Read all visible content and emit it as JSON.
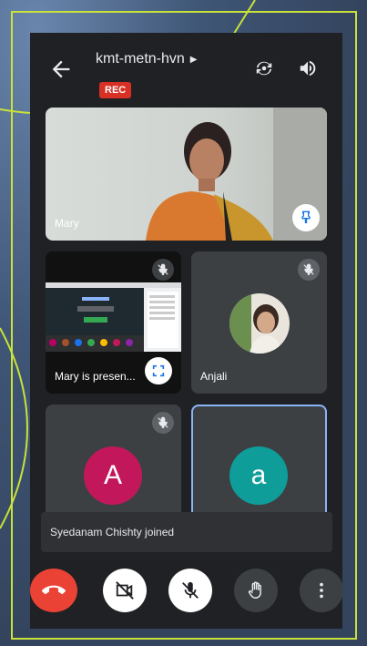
{
  "meeting": {
    "code": "kmt-metn-hvn",
    "rec_label": "REC"
  },
  "tiles": {
    "main": {
      "name": "Mary"
    },
    "presentation": {
      "name": "Mary is presen..."
    },
    "anjali": {
      "name": "Anjali"
    },
    "participant_a1": {
      "initial": "A"
    },
    "participant_a2": {
      "initial": "a"
    }
  },
  "toast": {
    "text": "Syedanam Chishty joined"
  },
  "colors": {
    "rec": "#d93025",
    "end_call": "#ea4335",
    "avatar_a1": "#c2185b",
    "avatar_a2": "#0f9d9a",
    "frame_accent": "#c9e23a"
  },
  "icons": {
    "back": "arrow-left-icon",
    "switch_camera": "camera-switch-icon",
    "speaker": "speaker-icon",
    "mic_off": "mic-off-icon",
    "pin": "pin-icon",
    "fullscreen": "fullscreen-icon",
    "end_call": "phone-hangup-icon",
    "camera_off": "video-off-icon",
    "raise_hand": "hand-icon",
    "more": "more-vert-icon"
  }
}
